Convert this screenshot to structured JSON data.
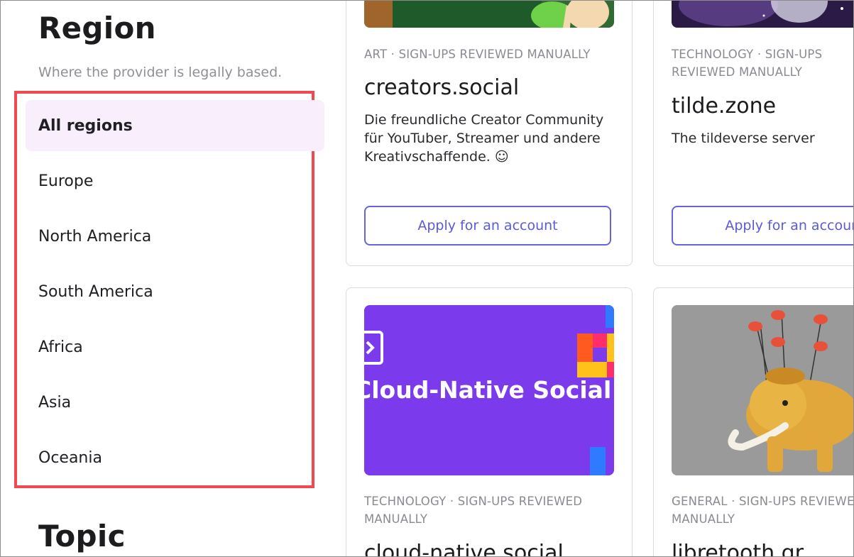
{
  "sidebar": {
    "region_title": "Region",
    "region_description": "Where the provider is legally based.",
    "regions": [
      {
        "label": "All regions",
        "active": true
      },
      {
        "label": "Europe"
      },
      {
        "label": "North America"
      },
      {
        "label": "South America"
      },
      {
        "label": "Africa"
      },
      {
        "label": "Asia"
      },
      {
        "label": "Oceania"
      }
    ],
    "topic_title": "Topic"
  },
  "servers": [
    {
      "meta": "ART · SIGN-UPS REVIEWED MANUALLY",
      "name": "creators.social",
      "description": "Die freundliche Creator Community für YouTuber, Streamer und andere Kreativschaffende. ☺",
      "button": "Apply for an account"
    },
    {
      "meta": "TECHNOLOGY · SIGN-UPS REVIEWED MANUALLY",
      "name": "tilde.zone",
      "description": "The tildeverse server",
      "button": "Apply for an account"
    },
    {
      "banner_text": "Cloud-Native Social",
      "meta": "TECHNOLOGY · SIGN-UPS REVIEWED MANUALLY",
      "name": "cloud-native.social"
    },
    {
      "meta": "GENERAL · SIGN-UPS REVIEWED MANUALLY",
      "name": "libretooth.gr"
    }
  ],
  "colors": {
    "accent": "#6564dd",
    "highlight_border": "#f2494f",
    "active_bg": "#f9eefc",
    "banner_purple": "#7c3aed"
  }
}
